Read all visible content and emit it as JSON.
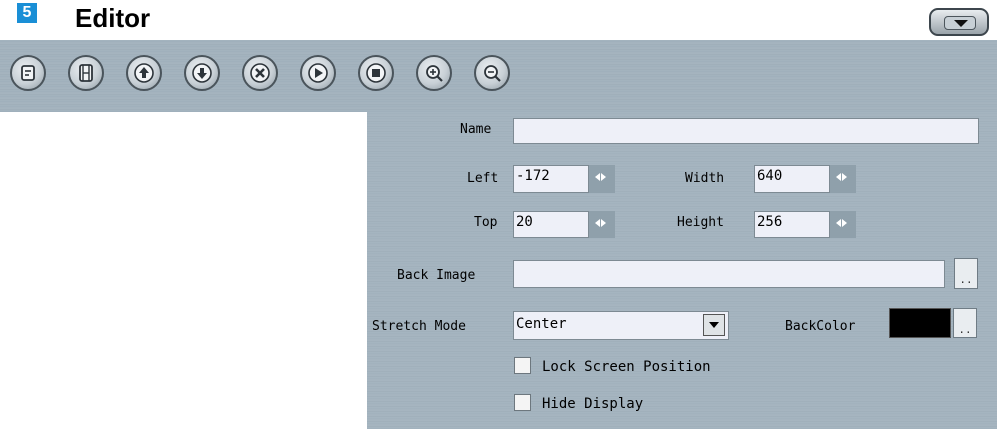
{
  "header": {
    "step_number": "5",
    "title": "Editor"
  },
  "toolbar": {
    "buttons": [
      {
        "name": "page-icon"
      },
      {
        "name": "film-icon"
      },
      {
        "name": "arrow-up-icon"
      },
      {
        "name": "arrow-down-icon"
      },
      {
        "name": "delete-icon"
      },
      {
        "name": "play-icon"
      },
      {
        "name": "stop-icon"
      },
      {
        "name": "zoom-in-icon"
      },
      {
        "name": "zoom-out-icon"
      }
    ]
  },
  "form": {
    "name_label": "Name",
    "name_value": "",
    "left_label": "Left",
    "left_value": "-172",
    "width_label": "Width",
    "width_value": "640",
    "top_label": "Top",
    "top_value": "20",
    "height_label": "Height",
    "height_value": "256",
    "back_image_label": "Back Image",
    "back_image_value": "",
    "browse_label": "..",
    "stretch_mode_label": "Stretch Mode",
    "stretch_mode_value": "Center",
    "back_color_label": "BackColor",
    "back_color_value": "#000000",
    "lock_label": "Lock Screen Position",
    "lock_checked": false,
    "hide_label": "Hide Display",
    "hide_checked": false
  }
}
